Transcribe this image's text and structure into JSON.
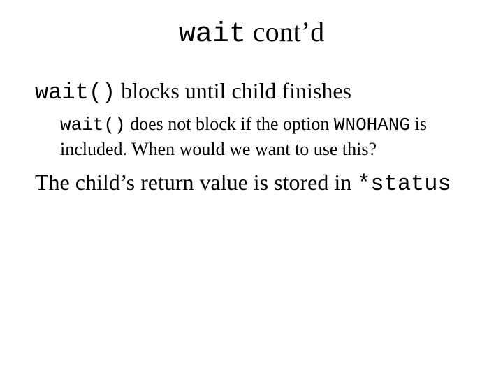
{
  "title": {
    "code": "wait",
    "rest": " cont’d"
  },
  "line1": {
    "code": "wait()",
    "rest": " blocks until child finishes"
  },
  "sub": {
    "code1": "wait()",
    "mid": " does not block if the option ",
    "code2": "WNOHANG",
    "tail": " is included.  When would we want to use this?"
  },
  "line2": {
    "lead": "The child’s return value is stored in ",
    "code": "*status"
  }
}
